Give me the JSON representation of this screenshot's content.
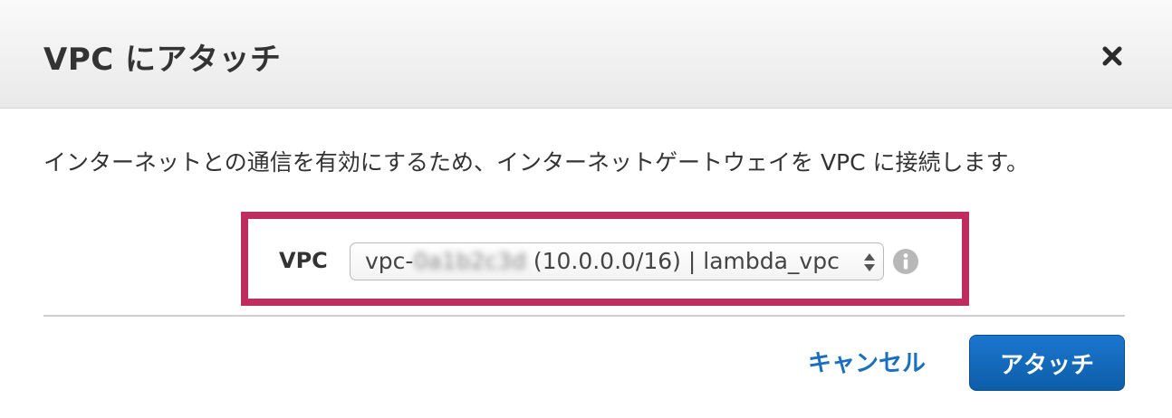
{
  "dialog": {
    "title": "VPC にアタッチ",
    "close_icon": "close-icon",
    "description": "インターネットとの通信を有効にするため、インターネットゲートウェイを VPC に接続します。"
  },
  "form": {
    "vpc_label": "VPC",
    "vpc_select": {
      "prefix": "vpc-",
      "masked_id": "0a1b2c3d",
      "suffix": " (10.0.0.0/16) | lambda_vpc"
    },
    "info_icon": "info-icon"
  },
  "footer": {
    "cancel_label": "キャンセル",
    "attach_label": "アタッチ"
  },
  "colors": {
    "highlight_border": "#bf2c5e",
    "primary_button": "#1a6fc0",
    "link": "#1a6fc0"
  }
}
